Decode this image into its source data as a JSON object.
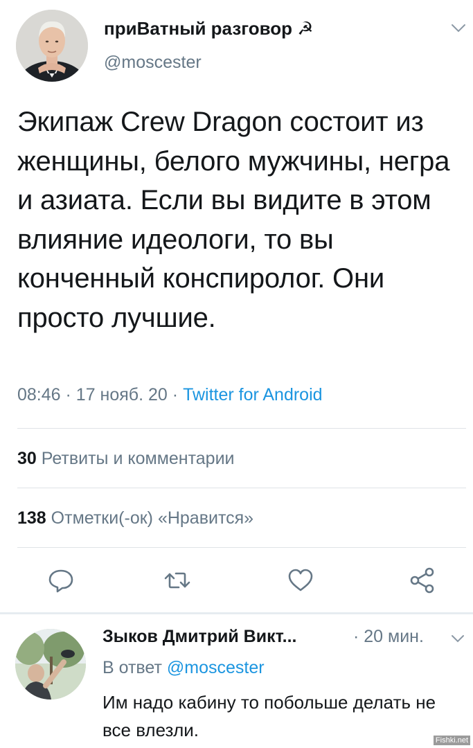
{
  "tweet": {
    "author": {
      "display_name": "приВатный разговор",
      "emoji": "☭",
      "handle": "@moscester"
    },
    "text": "Экипаж Crew Dragon состоит из женщины, белого мужчины, негра и азиата. Если вы видите в этом влияние идеологи, то вы конченный конспиролог. Они просто лучшие.",
    "time": "08:46",
    "date": "17 нояб. 20",
    "separator": "·",
    "source": "Twitter for Android",
    "stats": {
      "retweets_count": "30",
      "retweets_label": "Ретвиты и комментарии",
      "likes_count": "138",
      "likes_label": "Отметки(-ок) «Нравится»"
    },
    "actions": [
      "reply-icon",
      "retweet-icon",
      "like-icon",
      "share-icon"
    ]
  },
  "reply": {
    "display_name": "Зыков Дмитрий Викт...",
    "time": "· 20 мин.",
    "reply_prefix": "В ответ",
    "reply_mention": "@moscester",
    "text": "Им надо кабину то побольше делать не все влезли."
  },
  "watermark": "Fishki.net",
  "colors": {
    "text": "#14171a",
    "secondary": "#657786",
    "link": "#1b95e0",
    "divider": "#dfe3e7"
  }
}
